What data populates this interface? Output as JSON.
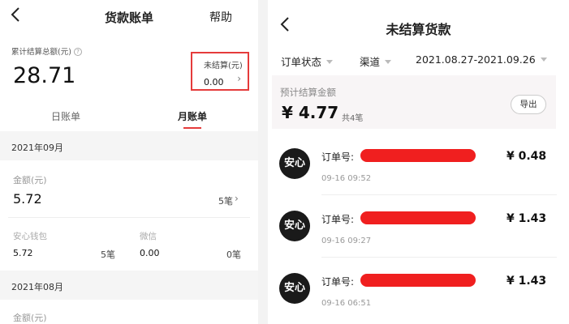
{
  "left": {
    "title": "货款账单",
    "help": "帮助",
    "total_label": "累计结算总额(元)",
    "info_icon": "?",
    "total_value": "28.71",
    "unsettled_label": "未结算(元)",
    "unsettled_value": "0.00",
    "chevron": "›",
    "tabs": {
      "day": "日账单",
      "month": "月账单"
    },
    "sections": [
      {
        "month": "2021年09月",
        "amount_label": "金额(元)",
        "amount": "5.72",
        "count": "5笔",
        "wallet_label": "安心钱包",
        "wallet_amount": "5.72",
        "wallet_count": "5笔",
        "wechat_label": "微信",
        "wechat_amount": "0.00",
        "wechat_count": "0笔"
      },
      {
        "month": "2021年08月",
        "amount_label": "金额(元)"
      }
    ]
  },
  "right": {
    "title": "未结算货款",
    "filters": {
      "status": "订单状态",
      "channel": "渠道",
      "date_range": "2021.08.27-2021.09.26"
    },
    "summary": {
      "label": "预计结算金额",
      "value": "¥ 4.77",
      "count": "共4笔",
      "export": "导出"
    },
    "orders": [
      {
        "badge": "安心",
        "no_label": "订单号:",
        "time": "09-16 09:52",
        "amount": "¥ 0.48"
      },
      {
        "badge": "安心",
        "no_label": "订单号:",
        "time": "09-16 09:27",
        "amount": "¥ 1.43"
      },
      {
        "badge": "安心",
        "no_label": "订单号:",
        "time": "09-16 06:51",
        "amount": "¥ 1.43"
      }
    ]
  },
  "colors": {
    "accent": "#e53b3b",
    "redaction": "#f01f1f",
    "badge_bg": "#1a1a1a"
  },
  "icons": {
    "back": "chevron-left-icon",
    "info": "info-icon",
    "caret": "caret-down-icon"
  }
}
